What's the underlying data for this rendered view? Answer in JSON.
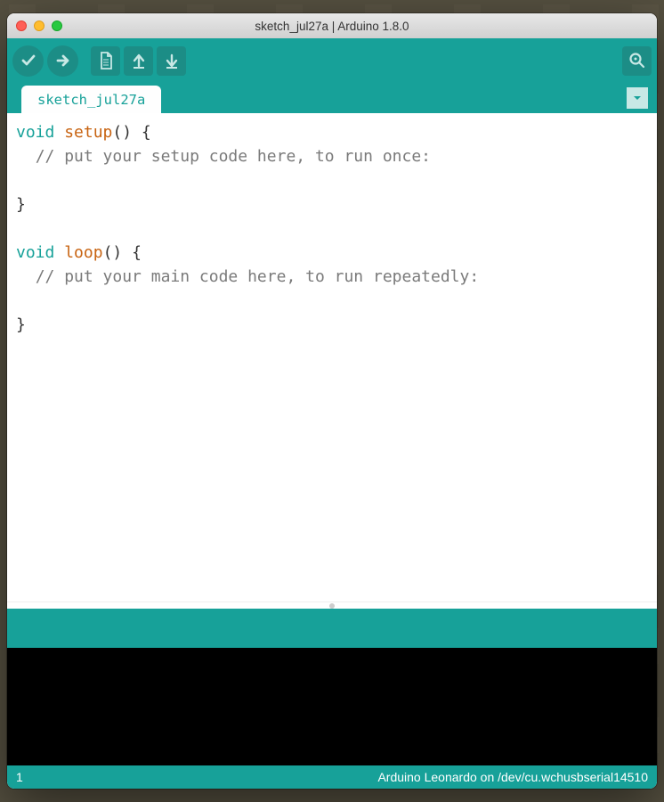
{
  "window": {
    "title": "sketch_jul27a | Arduino 1.8.0"
  },
  "toolbar": {
    "verify": "Verify",
    "upload": "Upload",
    "new": "New",
    "open": "Open",
    "save": "Save",
    "serial": "Serial Monitor"
  },
  "tabs": [
    {
      "label": "sketch_jul27a"
    }
  ],
  "code": {
    "lines": [
      {
        "tokens": [
          {
            "t": "kw",
            "v": "void"
          },
          {
            "t": "plain",
            "v": " "
          },
          {
            "t": "fn",
            "v": "setup"
          },
          {
            "t": "plain",
            "v": "()"
          },
          {
            "t": "plain",
            "v": " {"
          }
        ]
      },
      {
        "tokens": [
          {
            "t": "plain",
            "v": "  "
          },
          {
            "t": "cm",
            "v": "// put your setup code here, to run once:"
          }
        ]
      },
      {
        "tokens": [
          {
            "t": "plain",
            "v": ""
          }
        ]
      },
      {
        "tokens": [
          {
            "t": "plain",
            "v": "}"
          }
        ]
      },
      {
        "tokens": [
          {
            "t": "plain",
            "v": ""
          }
        ]
      },
      {
        "tokens": [
          {
            "t": "kw",
            "v": "void"
          },
          {
            "t": "plain",
            "v": " "
          },
          {
            "t": "fn",
            "v": "loop"
          },
          {
            "t": "plain",
            "v": "()"
          },
          {
            "t": "plain",
            "v": " {"
          }
        ]
      },
      {
        "tokens": [
          {
            "t": "plain",
            "v": "  "
          },
          {
            "t": "cm",
            "v": "// put your main code here, to run repeatedly:"
          }
        ]
      },
      {
        "tokens": [
          {
            "t": "plain",
            "v": ""
          }
        ]
      },
      {
        "tokens": [
          {
            "t": "plain",
            "v": "}"
          }
        ]
      }
    ]
  },
  "footer": {
    "line": "1",
    "board": "Arduino Leonardo on /dev/cu.wchusbserial14510"
  }
}
